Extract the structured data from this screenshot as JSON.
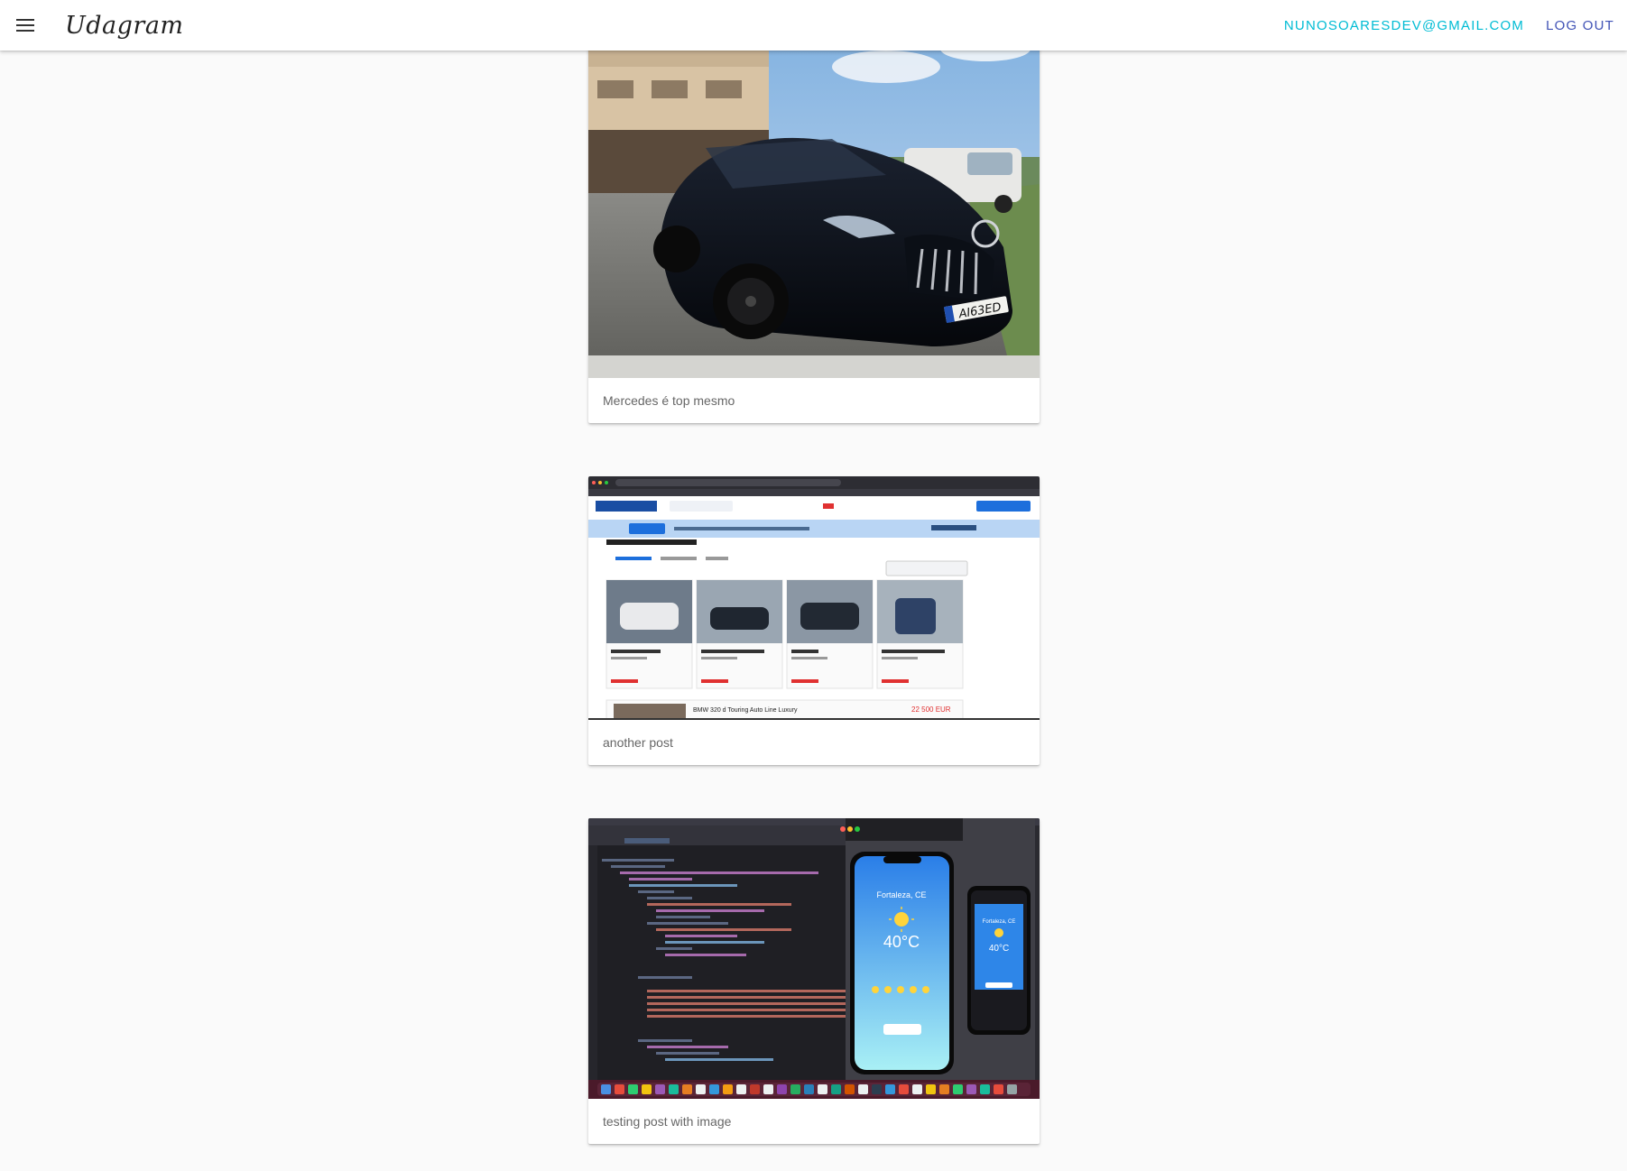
{
  "app": {
    "title": "Udagram",
    "user_email": "NUNOSOARESDEV@GMAIL.COM",
    "logout_label": "LOG OUT"
  },
  "colors": {
    "email": "#00bcd4",
    "logout": "#3f51b5",
    "background": "#fafafa"
  },
  "icons": {
    "menu": "hamburger-menu-icon"
  },
  "posts": [
    {
      "caption": "Mercedes é top mesmo",
      "image": "black-mercedes-convertible-photo"
    },
    {
      "caption": "another post",
      "image": "car-listing-website-screenshot"
    },
    {
      "caption": "testing post with image",
      "image": "xcode-weather-app-screenshot"
    }
  ],
  "screenshot_text": {
    "weather_city": "Fortaleza, CE",
    "weather_temp": "40°C",
    "listing_price": "22 500 EUR",
    "listing_title": "BMW 320 d Touring Auto Line Luxury"
  }
}
